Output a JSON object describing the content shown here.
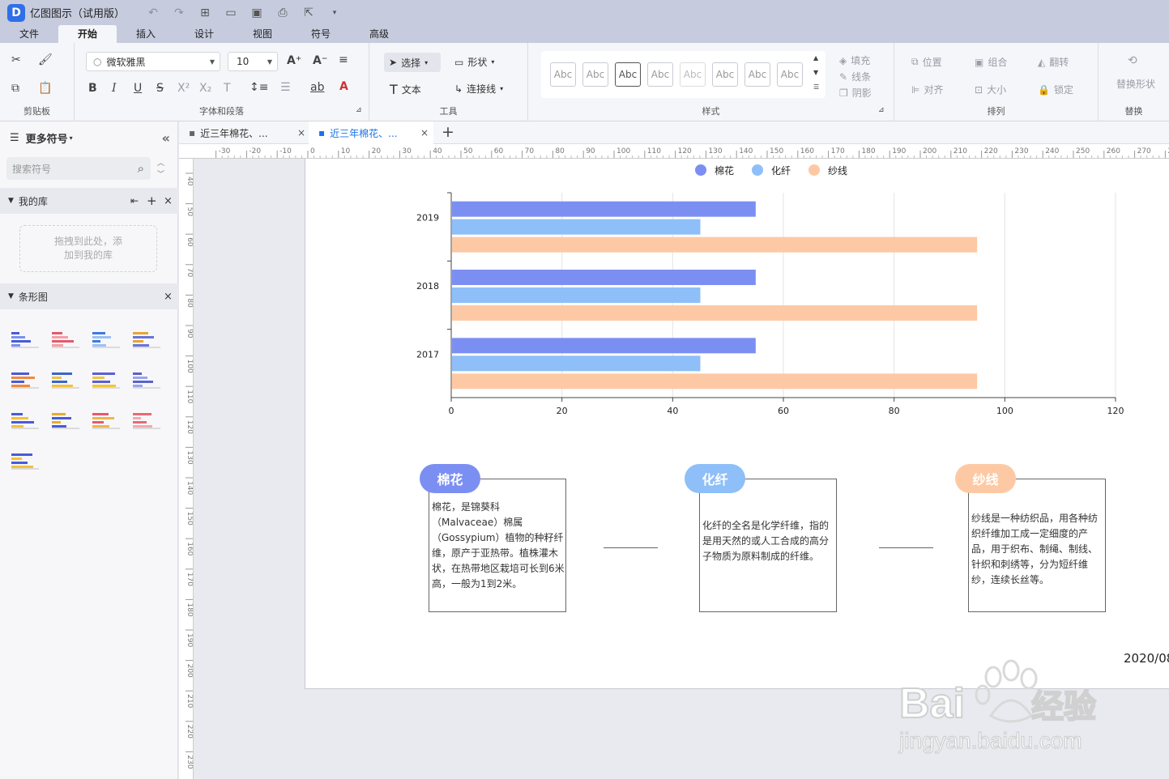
{
  "app": {
    "title": "亿图图示（试用版）",
    "logo_letter": "D"
  },
  "menu": {
    "tabs": [
      "文件",
      "开始",
      "插入",
      "设计",
      "视图",
      "符号",
      "高级"
    ],
    "active": "开始"
  },
  "ribbon": {
    "clipboard_label": "剪贴板",
    "font_label": "字体和段落",
    "font_family": "微软雅黑",
    "font_size": "10",
    "tools_label": "工具",
    "select": "选择",
    "shape": "形状",
    "text": "文本",
    "connector": "连接线",
    "styles_label": "样式",
    "style_sample": "Abc",
    "fill": "填充",
    "line": "线条",
    "shadow": "阴影",
    "position": "位置",
    "group": "组合",
    "flip": "翻转",
    "align": "对齐",
    "size": "大小",
    "lock": "锁定",
    "arrange_label": "排列",
    "replace_shape": "替换形状",
    "replace_label": "替换"
  },
  "sidebar": {
    "title": "更多符号",
    "search_placeholder": "搜索符号",
    "my_library": "我的库",
    "drop_hint_1": "拖拽到此处，添",
    "drop_hint_2": "加到我的库",
    "bar_section": "条形图"
  },
  "doc_tabs": [
    {
      "label": "近三年棉花、..."
    },
    {
      "label": "近三年棉花、..."
    }
  ],
  "ruler": {
    "top": [
      "-30",
      "-20",
      "-10",
      "0",
      "10",
      "20",
      "30",
      "40",
      "50",
      "60",
      "70",
      "80",
      "90",
      "100",
      "110",
      "120",
      "130",
      "140",
      "150",
      "160",
      "170",
      "180",
      "190",
      "200",
      "210",
      "220",
      "230",
      "240",
      "250",
      "260",
      "270",
      "28"
    ],
    "left": [
      "40",
      "50",
      "60",
      "70",
      "80",
      "90",
      "100",
      "110",
      "120",
      "130",
      "140",
      "150",
      "160",
      "170",
      "180",
      "190",
      "200",
      "210",
      "220",
      "230"
    ]
  },
  "chart_data": {
    "type": "bar",
    "orientation": "horizontal",
    "categories": [
      "2019",
      "2018",
      "2017"
    ],
    "series": [
      {
        "name": "棉花",
        "values": [
          55,
          55,
          55
        ],
        "color": "#7b8ff3"
      },
      {
        "name": "化纤",
        "values": [
          45,
          45,
          45
        ],
        "color": "#8ebff8"
      },
      {
        "name": "纱线",
        "values": [
          95,
          95,
          95
        ],
        "color": "#fdc9a4"
      }
    ],
    "xlim": [
      0,
      120
    ],
    "xticks": [
      "0",
      "20",
      "40",
      "60",
      "80",
      "100",
      "120"
    ],
    "legend_position": "top-center",
    "grid": "vertical"
  },
  "cards": [
    {
      "title": "棉花",
      "color": "#7b8ff3",
      "text": "棉花，是锦葵科（Malvaceae）棉属（Gossypium）植物的种籽纤维，原产于亚热带。植株灌木状，在热带地区栽培可长到6米高，一般为1到2米。"
    },
    {
      "title": "化纤",
      "color": "#8ebff8",
      "text": "化纤的全名是化学纤维，指的是用天然的或人工合成的高分子物质为原料制成的纤维。"
    },
    {
      "title": "纱线",
      "color": "#fdc9a4",
      "text": "纱线是一种纺织品，用各种纺织纤维加工成一定细度的产品，用于织布、制绳、制线、针织和刺绣等，分为短纤维纱，连续长丝等。"
    }
  ],
  "date_text": "2020/08",
  "watermark": {
    "brand": "Bai",
    "brand2": "经验",
    "url": "jingyan.baidu.com"
  }
}
